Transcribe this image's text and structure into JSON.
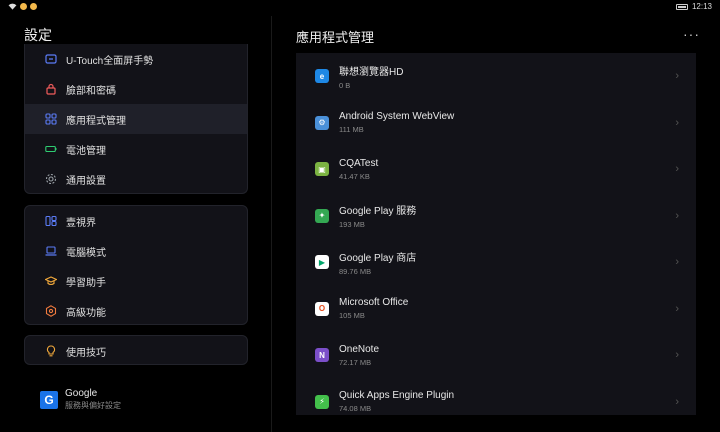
{
  "status": {
    "time": "12:13"
  },
  "left": {
    "title": "設定",
    "group1": [
      {
        "label": "U-Touch全面屏手勢",
        "icon": "gesture-icon",
        "color": "#5b7cf7"
      },
      {
        "label": "臉部和密碼",
        "icon": "lock-icon",
        "color": "#f25c5c"
      },
      {
        "label": "應用程式管理",
        "icon": "apps-grid-icon",
        "color": "#5b7cf7"
      },
      {
        "label": "電池管理",
        "icon": "battery-icon",
        "color": "#2ecc71"
      },
      {
        "label": "通用設置",
        "icon": "gear-icon",
        "color": "#9aa0a6"
      }
    ],
    "group2": [
      {
        "label": "壹視界",
        "icon": "split-view-icon",
        "color": "#5b7cf7"
      },
      {
        "label": "電腦模式",
        "icon": "laptop-icon",
        "color": "#5b7cf7"
      },
      {
        "label": "學習助手",
        "icon": "graduation-cap-icon",
        "color": "#f2a93b"
      },
      {
        "label": "高級功能",
        "icon": "hexagon-icon",
        "color": "#f07a3e"
      }
    ],
    "group3": [
      {
        "label": "使用技巧",
        "icon": "lightbulb-icon",
        "color": "#f2a93b"
      }
    ],
    "google": {
      "title": "Google",
      "subtitle": "服務與偏好設定"
    }
  },
  "right": {
    "title": "應用程式管理",
    "more": "···",
    "apps": [
      {
        "name": "聯想瀏覽器HD",
        "size": "0 B",
        "icon": "browser-icon",
        "bg": "#1e88e5",
        "glyph": "e"
      },
      {
        "name": "Android System WebView",
        "size": "111 MB",
        "icon": "webview-icon",
        "bg": "#4a90d9",
        "glyph": "⚙"
      },
      {
        "name": "CQATest",
        "size": "41.47 KB",
        "icon": "cqatest-icon",
        "bg": "#7cb342",
        "glyph": "▣"
      },
      {
        "name": "Google Play 服務",
        "size": "193 MB",
        "icon": "play-services-icon",
        "bg": "#34a853",
        "glyph": "✦"
      },
      {
        "name": "Google Play 商店",
        "size": "89.76 MB",
        "icon": "play-store-icon",
        "bg": "#ffffff",
        "glyph": "▶"
      },
      {
        "name": "Microsoft Office",
        "size": "105 MB",
        "icon": "office-icon",
        "bg": "#ffffff",
        "glyph": "O"
      },
      {
        "name": "OneNote",
        "size": "72.17 MB",
        "icon": "onenote-icon",
        "bg": "#7b4fc9",
        "glyph": "N"
      },
      {
        "name": "Quick Apps Engine Plugin",
        "size": "74.08 MB",
        "icon": "quick-apps-icon",
        "bg": "#43c04b",
        "glyph": "⚡"
      }
    ]
  }
}
